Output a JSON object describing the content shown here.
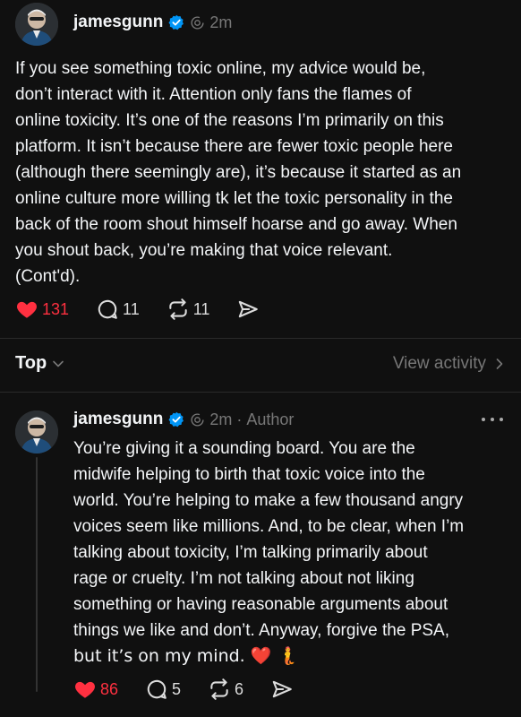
{
  "post": {
    "username": "jamesgunn",
    "time": "2m",
    "lines": [
      "If you see something toxic online, my advice would be,",
      "don’t interact with it. Attention only fans the flames of",
      "online toxicity. It’s one of the reasons I’m primarily on this",
      "platform. It isn’t because there are fewer toxic people here",
      "(although there seemingly are), it’s because it started as an",
      "online culture more willing tk let the toxic personality in the",
      "back of the room shout himself hoarse and go away. When",
      "you shout back, you’re making that voice relevant.",
      "(Cont'd)."
    ],
    "likes": "131",
    "replies": "11",
    "reposts": "11"
  },
  "sort": {
    "label": "Top",
    "activity_label": "View activity"
  },
  "reply": {
    "username": "jamesgunn",
    "time": "2m",
    "separator": "·",
    "author_label": "Author",
    "lines": [
      "You’re giving it a sounding board. You are the",
      "midwife helping to birth that toxic voice into the",
      "world. You’re helping to make a few thousand angry",
      "voices seem like millions. And, to be clear, when I’m",
      "talking about toxicity, I’m talking primarily about",
      "rage or cruelty. I’m not talking about not liking",
      "something or having reasonable arguments about",
      "things we like and don’t. Anyway, forgive the PSA,",
      "but it’s on my mind. ❤️ 🧜"
    ],
    "likes": "86",
    "replies": "5",
    "reposts": "6"
  },
  "colors": {
    "background": "#101010",
    "like_red": "#ff3040",
    "verified_blue": "#0095f6",
    "muted": "#777777"
  },
  "icons": [
    "verified-icon",
    "threads-sync-icon",
    "heart-icon",
    "reply-icon",
    "repost-icon",
    "share-icon",
    "chevron-down-icon",
    "chevron-right-icon",
    "more-icon"
  ]
}
